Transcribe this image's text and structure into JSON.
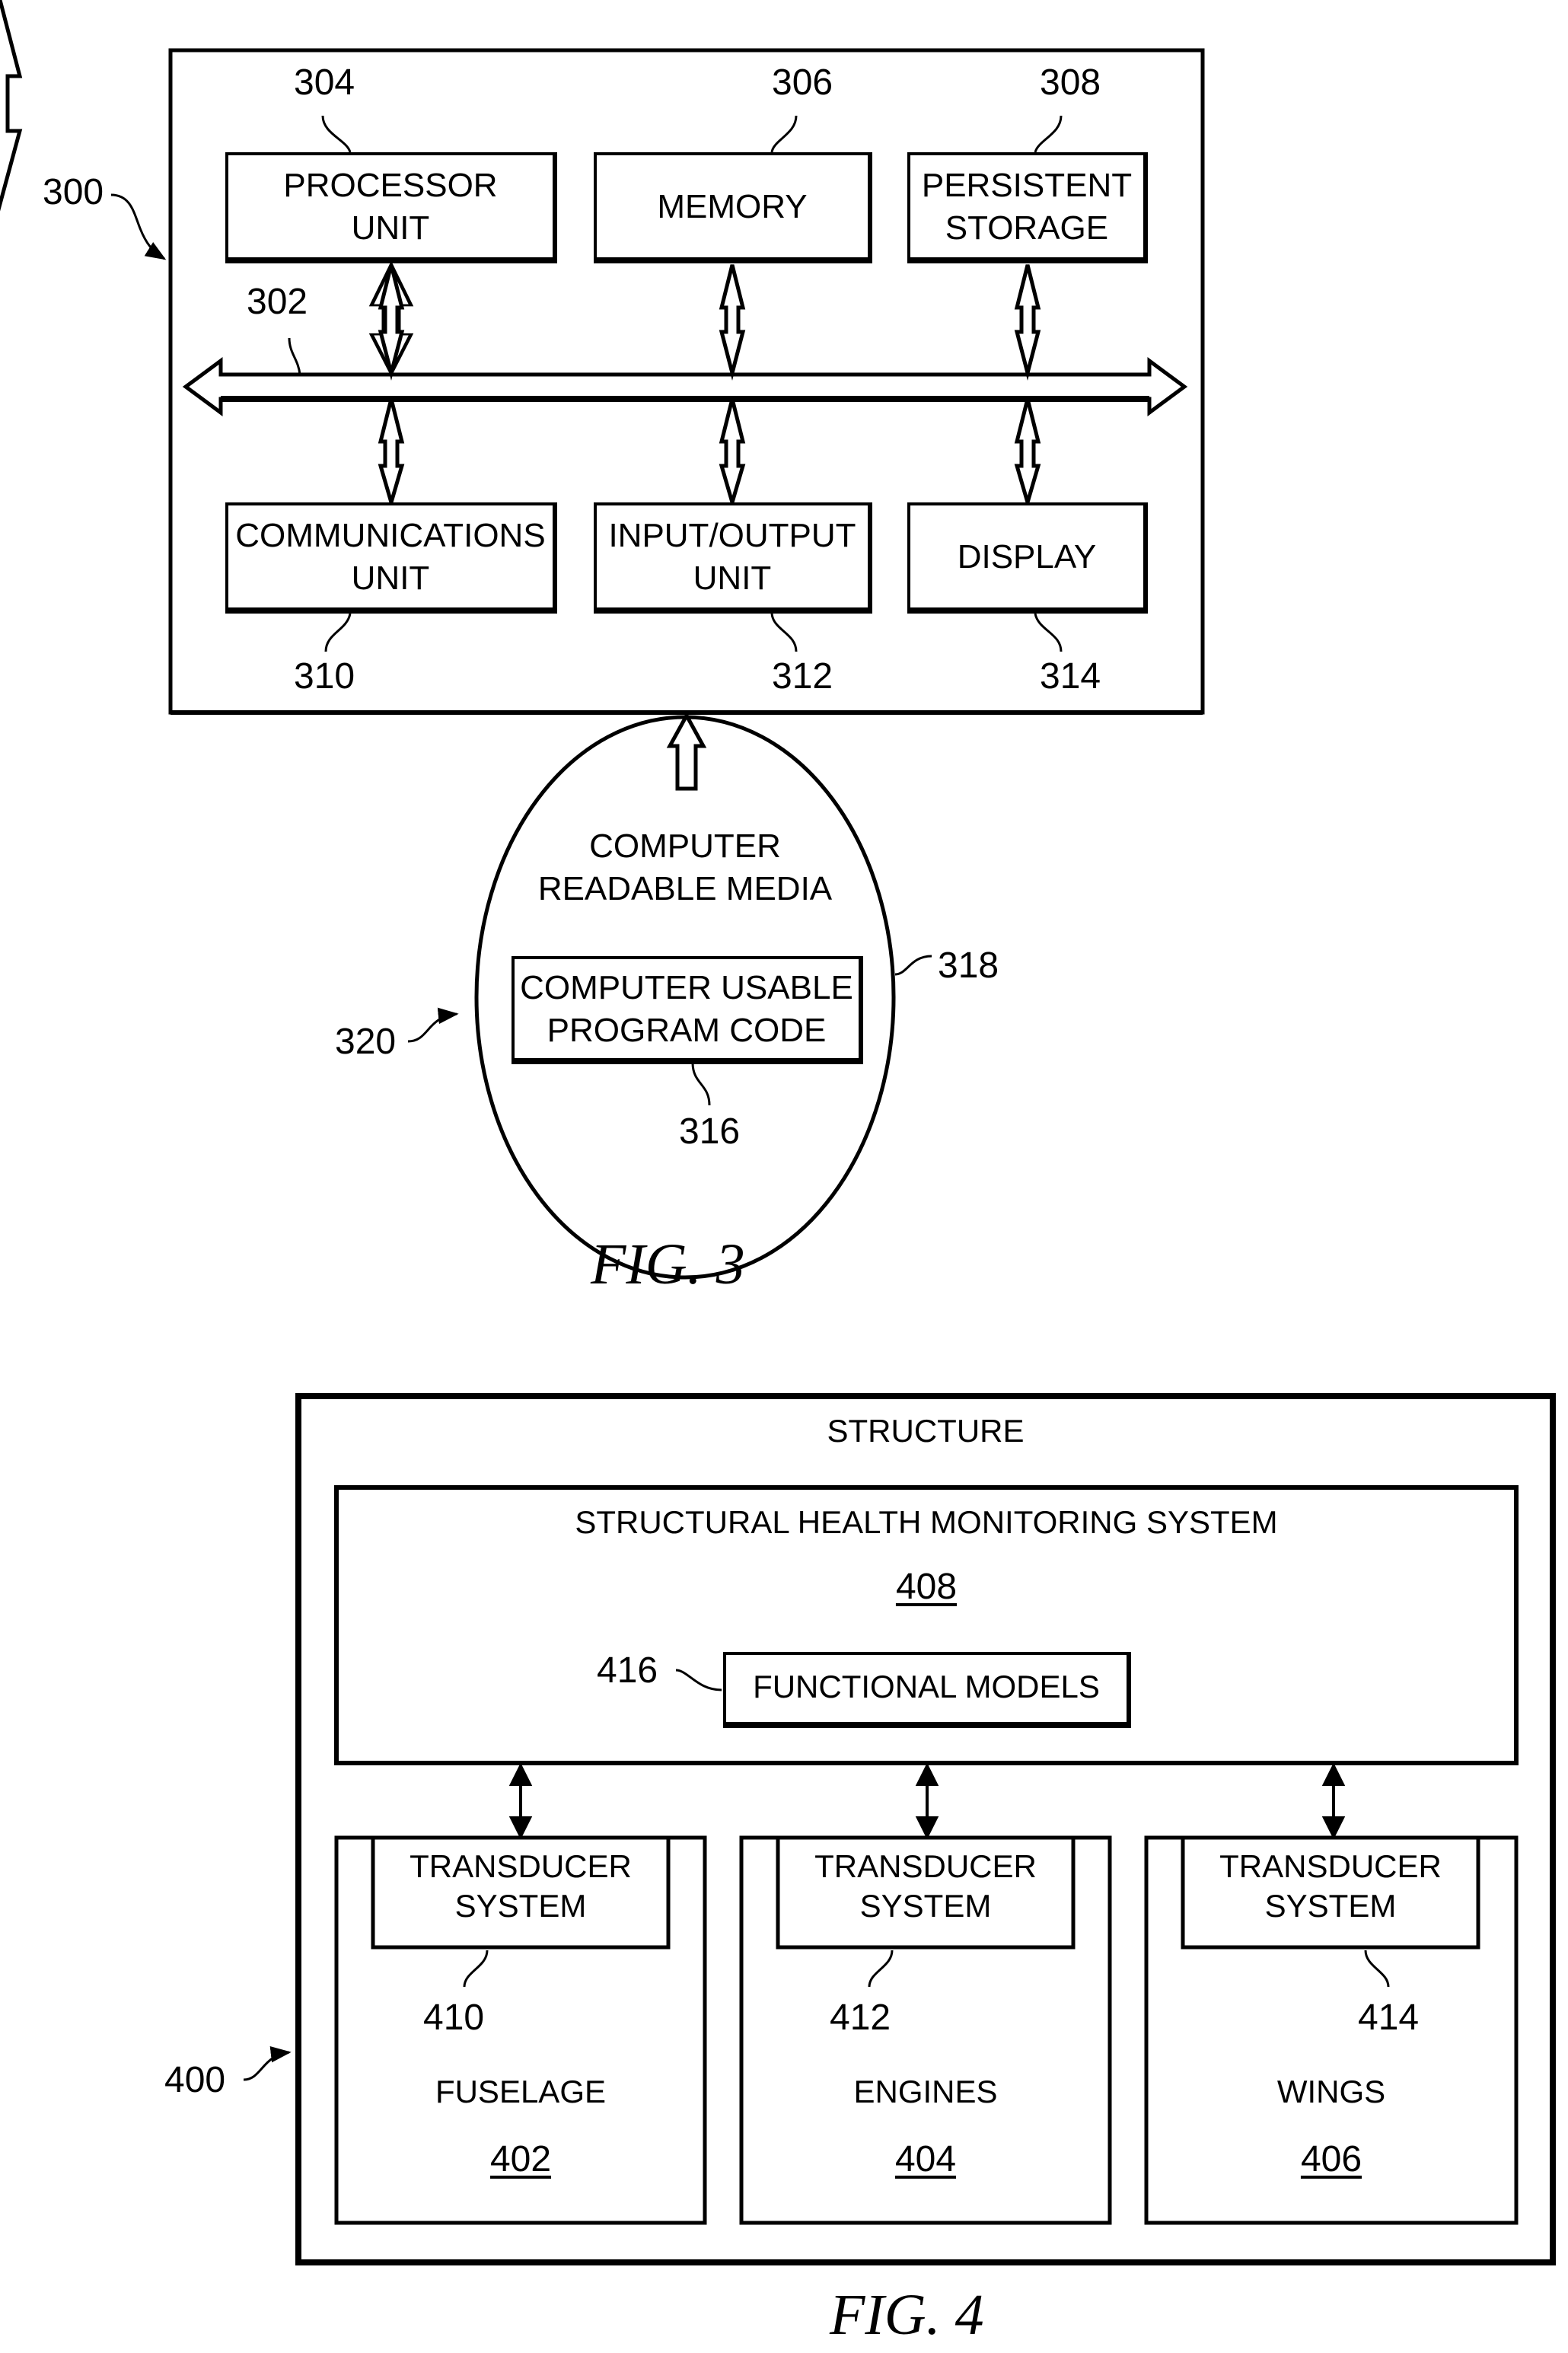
{
  "fig3": {
    "caption": "FIG. 3",
    "system_ref": "300",
    "bus_ref": "302",
    "components": [
      {
        "ref": "304",
        "line1": "PROCESSOR",
        "line2": "UNIT"
      },
      {
        "ref": "306",
        "line1": "MEMORY",
        "line2": ""
      },
      {
        "ref": "308",
        "line1": "PERSISTENT",
        "line2": "STORAGE"
      },
      {
        "ref": "310",
        "line1": "COMMUNICATIONS",
        "line2": "UNIT"
      },
      {
        "ref": "312",
        "line1": "INPUT/OUTPUT",
        "line2": "UNIT"
      },
      {
        "ref": "314",
        "line1": "DISPLAY",
        "line2": ""
      }
    ],
    "media": {
      "line1": "COMPUTER",
      "line2": "READABLE MEDIA",
      "ref": "318",
      "pointer_ref": "320",
      "code_line1": "COMPUTER USABLE",
      "code_line2": "PROGRAM CODE",
      "code_ref": "316"
    }
  },
  "fig4": {
    "caption": "FIG. 4",
    "structure_ref": "400",
    "structure_label": "STRUCTURE",
    "shm_label": "STRUCTURAL HEALTH MONITORING SYSTEM",
    "shm_ref": "408",
    "models_label": "FUNCTIONAL MODELS",
    "models_ref": "416",
    "parts": [
      {
        "name": "FUSELAGE",
        "ref": "402",
        "transducer_line1": "TRANSDUCER",
        "transducer_line2": "SYSTEM",
        "transducer_ref": "410"
      },
      {
        "name": "ENGINES",
        "ref": "404",
        "transducer_line1": "TRANSDUCER",
        "transducer_line2": "SYSTEM",
        "transducer_ref": "412"
      },
      {
        "name": "WINGS",
        "ref": "406",
        "transducer_line1": "TRANSDUCER",
        "transducer_line2": "SYSTEM",
        "transducer_ref": "414"
      }
    ]
  }
}
